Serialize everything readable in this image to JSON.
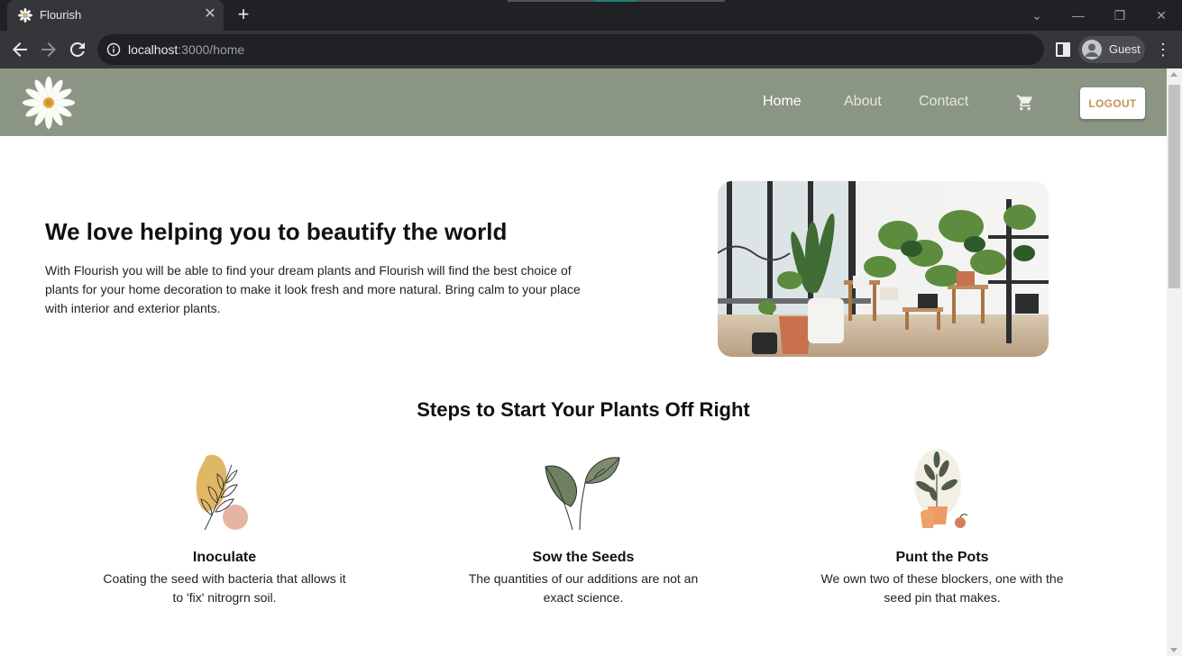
{
  "browser": {
    "tab_title": "Flourish",
    "url_host": "localhost",
    "url_path": ":3000/home",
    "profile_name": "Guest"
  },
  "header": {
    "nav": [
      "Home",
      "About",
      "Contact"
    ],
    "logout_label": "LOGOUT"
  },
  "hero": {
    "title": "We love helping you to beautify the world",
    "text": "With Flourish you will be able to find your dream plants and Flourish will find the best choice of plants for your home decoration to make it look fresh and more natural. Bring calm to your place with interior and exterior plants."
  },
  "steps": {
    "title": "Steps to Start Your Plants Off Right",
    "items": [
      {
        "title": "Inoculate",
        "text": "Coating the seed with bacteria that allows it to 'fix' nitrogrn soil.",
        "icon": "leaf-branch-icon"
      },
      {
        "title": "Sow the Seeds",
        "text": "The quantities of our additions are not an exact science.",
        "icon": "two-leaves-icon"
      },
      {
        "title": "Punt the Pots",
        "text": "We own two of these blockers, one with the seed pin that makes.",
        "icon": "potted-plant-icon"
      }
    ]
  },
  "colors": {
    "header_bg": "#8a9683",
    "logout_text": "#c4915a"
  }
}
